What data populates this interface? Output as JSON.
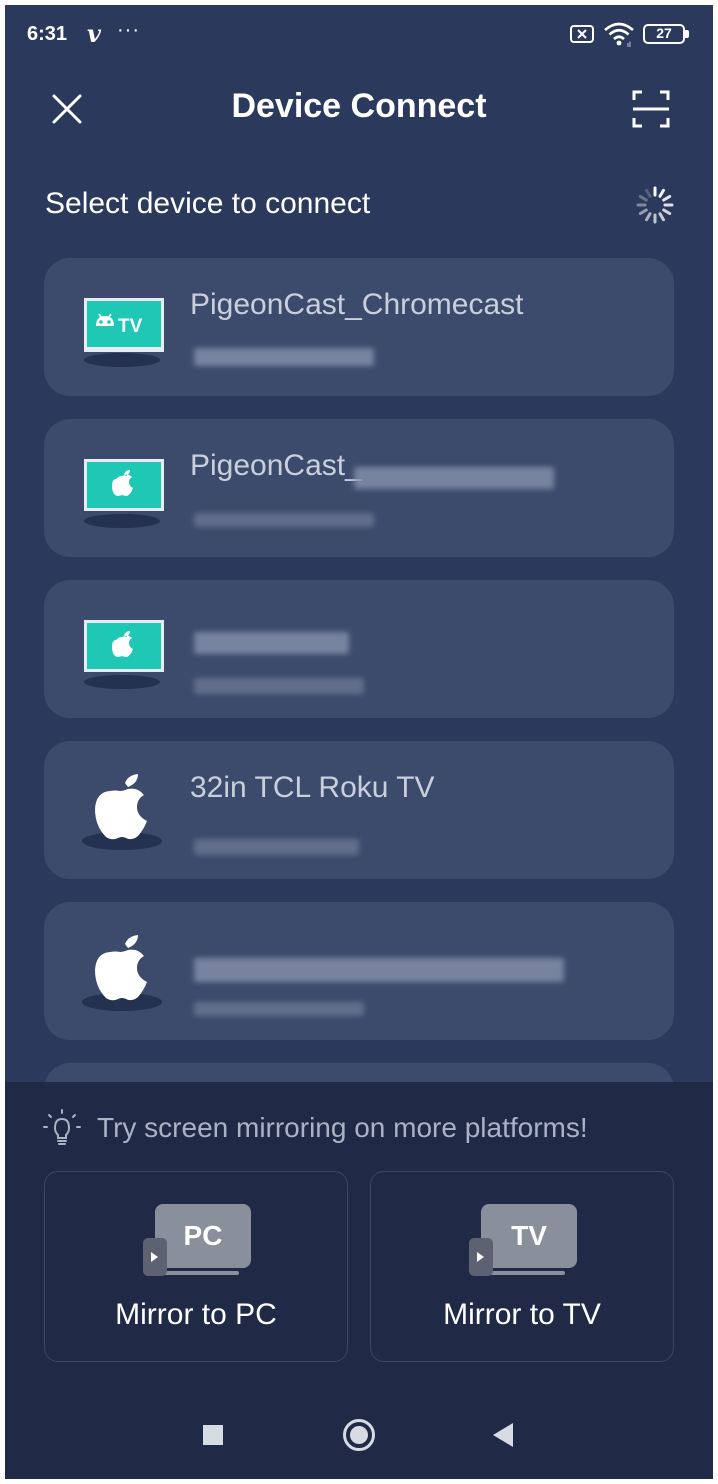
{
  "status_bar": {
    "time": "6:31",
    "app_glyph": "v",
    "more": "···",
    "battery": "27"
  },
  "header": {
    "title": "Device Connect",
    "close_icon": "close-icon",
    "scan_icon": "scan-icon"
  },
  "subtitle": "Select device to connect",
  "devices": [
    {
      "name": "PigeonCast_Chromecast",
      "icon": "android-tv-icon"
    },
    {
      "name": "PigeonCast_",
      "icon": "apple-tv-icon"
    },
    {
      "name": "",
      "icon": "apple-tv-icon"
    },
    {
      "name": "32in TCL Roku TV",
      "icon": "apple-logo-icon"
    },
    {
      "name": "",
      "icon": "apple-logo-icon"
    }
  ],
  "tip": "Try screen mirroring on more platforms!",
  "mirror_options": [
    {
      "badge": "PC",
      "label": "Mirror to PC"
    },
    {
      "badge": "TV",
      "label": "Mirror to TV"
    }
  ],
  "colors": {
    "background": "#2b3a5c",
    "card": "#3c4a6b",
    "bottom_panel": "#202a46",
    "tv_accent": "#1ec8b4"
  }
}
